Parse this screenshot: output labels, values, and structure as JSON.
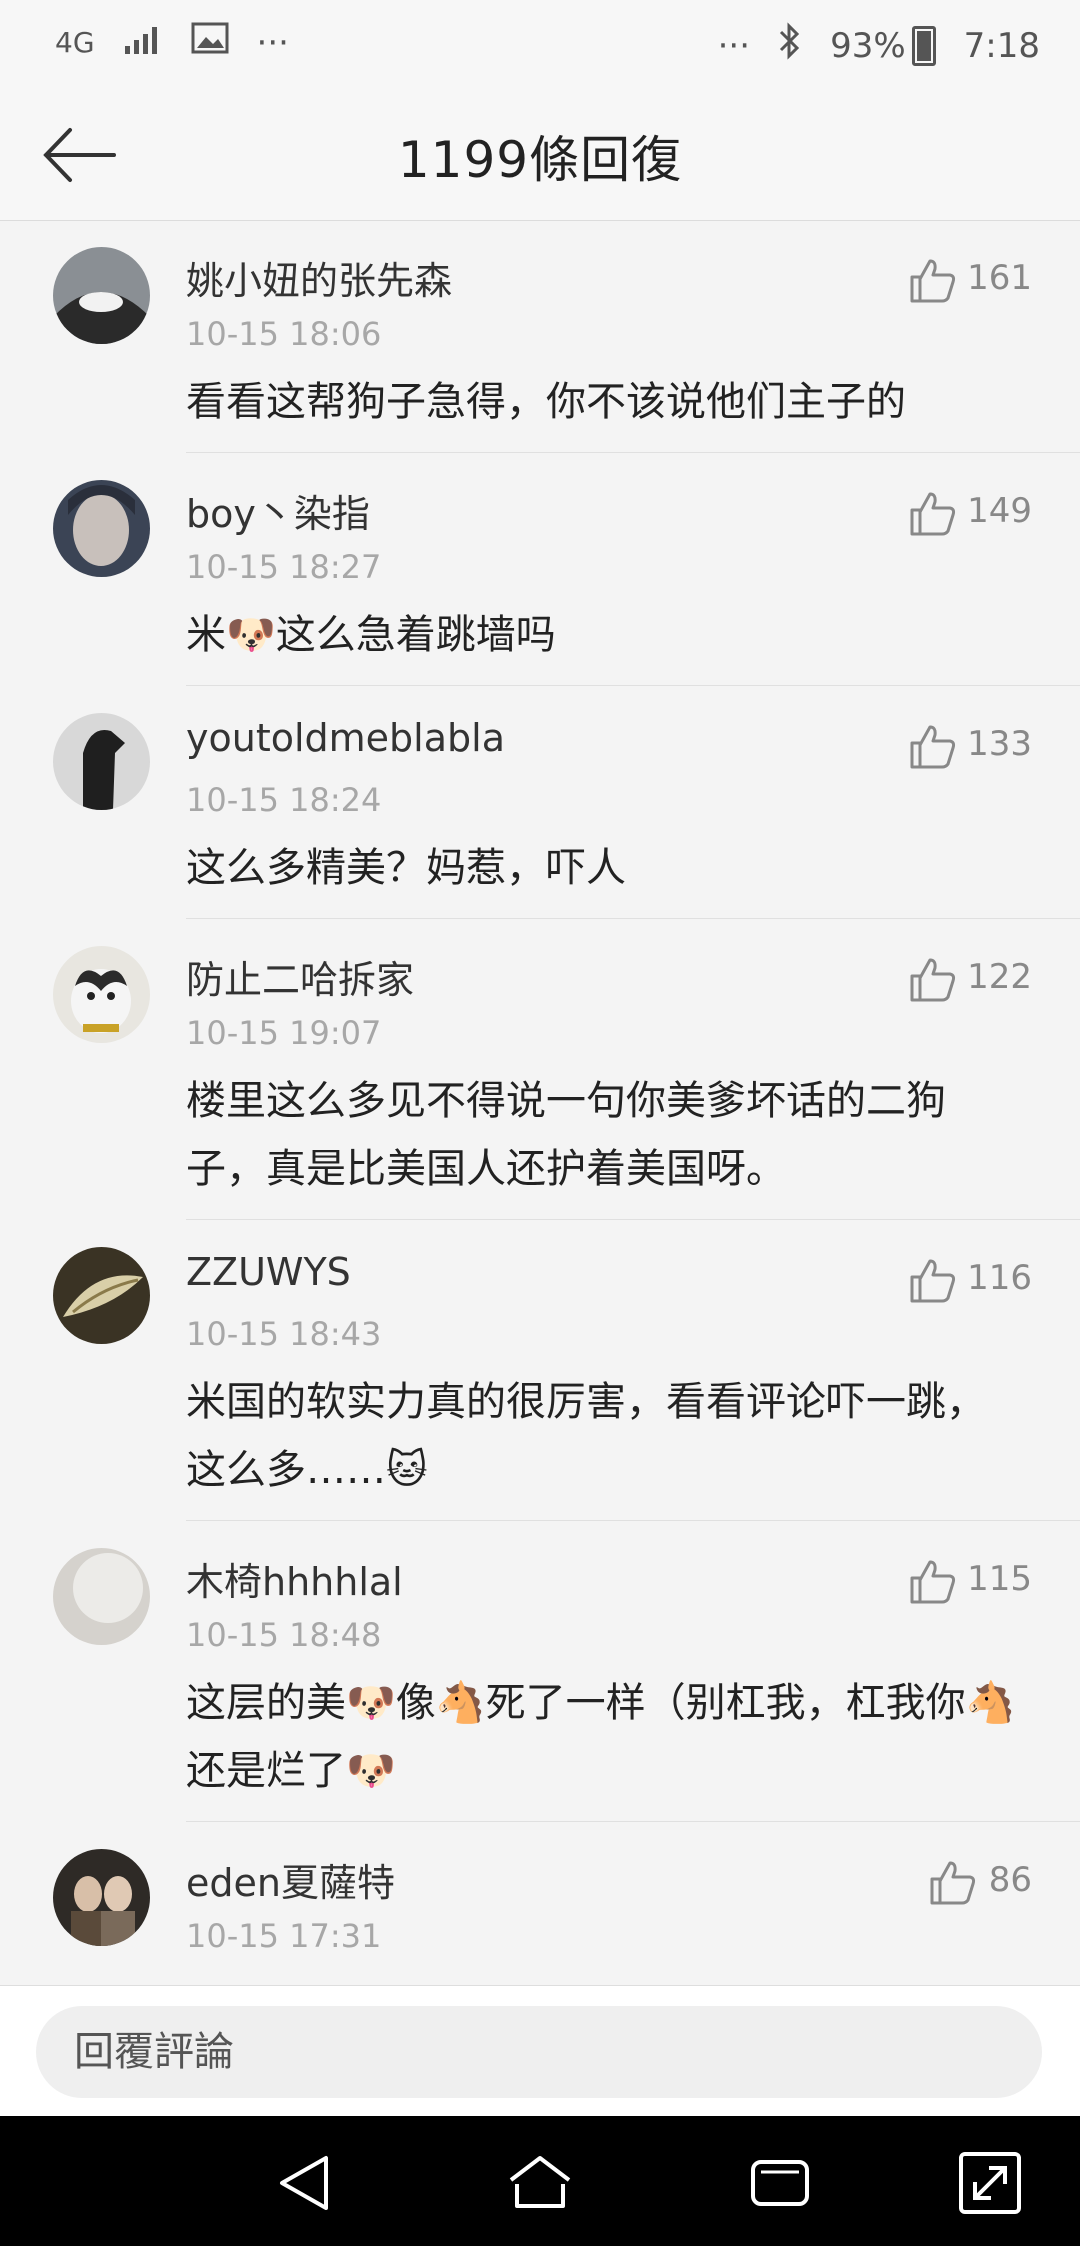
{
  "status_bar": {
    "network": "4G",
    "more_left": "···",
    "more_right": "···",
    "battery": "93%",
    "time": "7:18"
  },
  "header": {
    "title": "1199條回復"
  },
  "comments": [
    {
      "username": "姚小妞的张先森",
      "time": "10-15 18:06",
      "likes": "161",
      "text": "看看这帮狗子急得，你不该说他们主子的"
    },
    {
      "username": "boy丶染指",
      "time": "10-15 18:27",
      "likes": "149",
      "text": "米🐶这么急着跳墙吗"
    },
    {
      "username": "youtoldmeblabla",
      "time": "10-15 18:24",
      "likes": "133",
      "text": "这么多精美？妈惹，吓人"
    },
    {
      "username": "防止二哈拆家",
      "time": "10-15 19:07",
      "likes": "122",
      "text": "楼里这么多见不得说一句你美爹坏话的二狗子，真是比美国人还护着美国呀。"
    },
    {
      "username": "ZZUWYS",
      "time": "10-15 18:43",
      "likes": "116",
      "text": "米国的软实力真的很厉害，看看评论吓一跳，这么多……🐱"
    },
    {
      "username": "木椅hhhhlal",
      "time": "10-15 18:48",
      "likes": "115",
      "text": "这层的美🐶像🐴死了一样（别杠我，杠我你🐴还是烂了🐶"
    },
    {
      "username": "eden夏薩特",
      "time": "10-15 17:31",
      "likes": "86",
      "text": ""
    }
  ],
  "reply": {
    "placeholder": "回覆評論"
  },
  "colors": {
    "background": "#f4f4f4",
    "text_primary": "#222222",
    "text_secondary": "#a7a7a7",
    "nav_bar": "#000000"
  },
  "icons": [
    "back-arrow-icon",
    "thumbs-up-icon",
    "bluetooth-icon",
    "signal-icon",
    "image-icon",
    "back-triangle-icon",
    "home-icon",
    "recents-icon",
    "expand-icon"
  ]
}
